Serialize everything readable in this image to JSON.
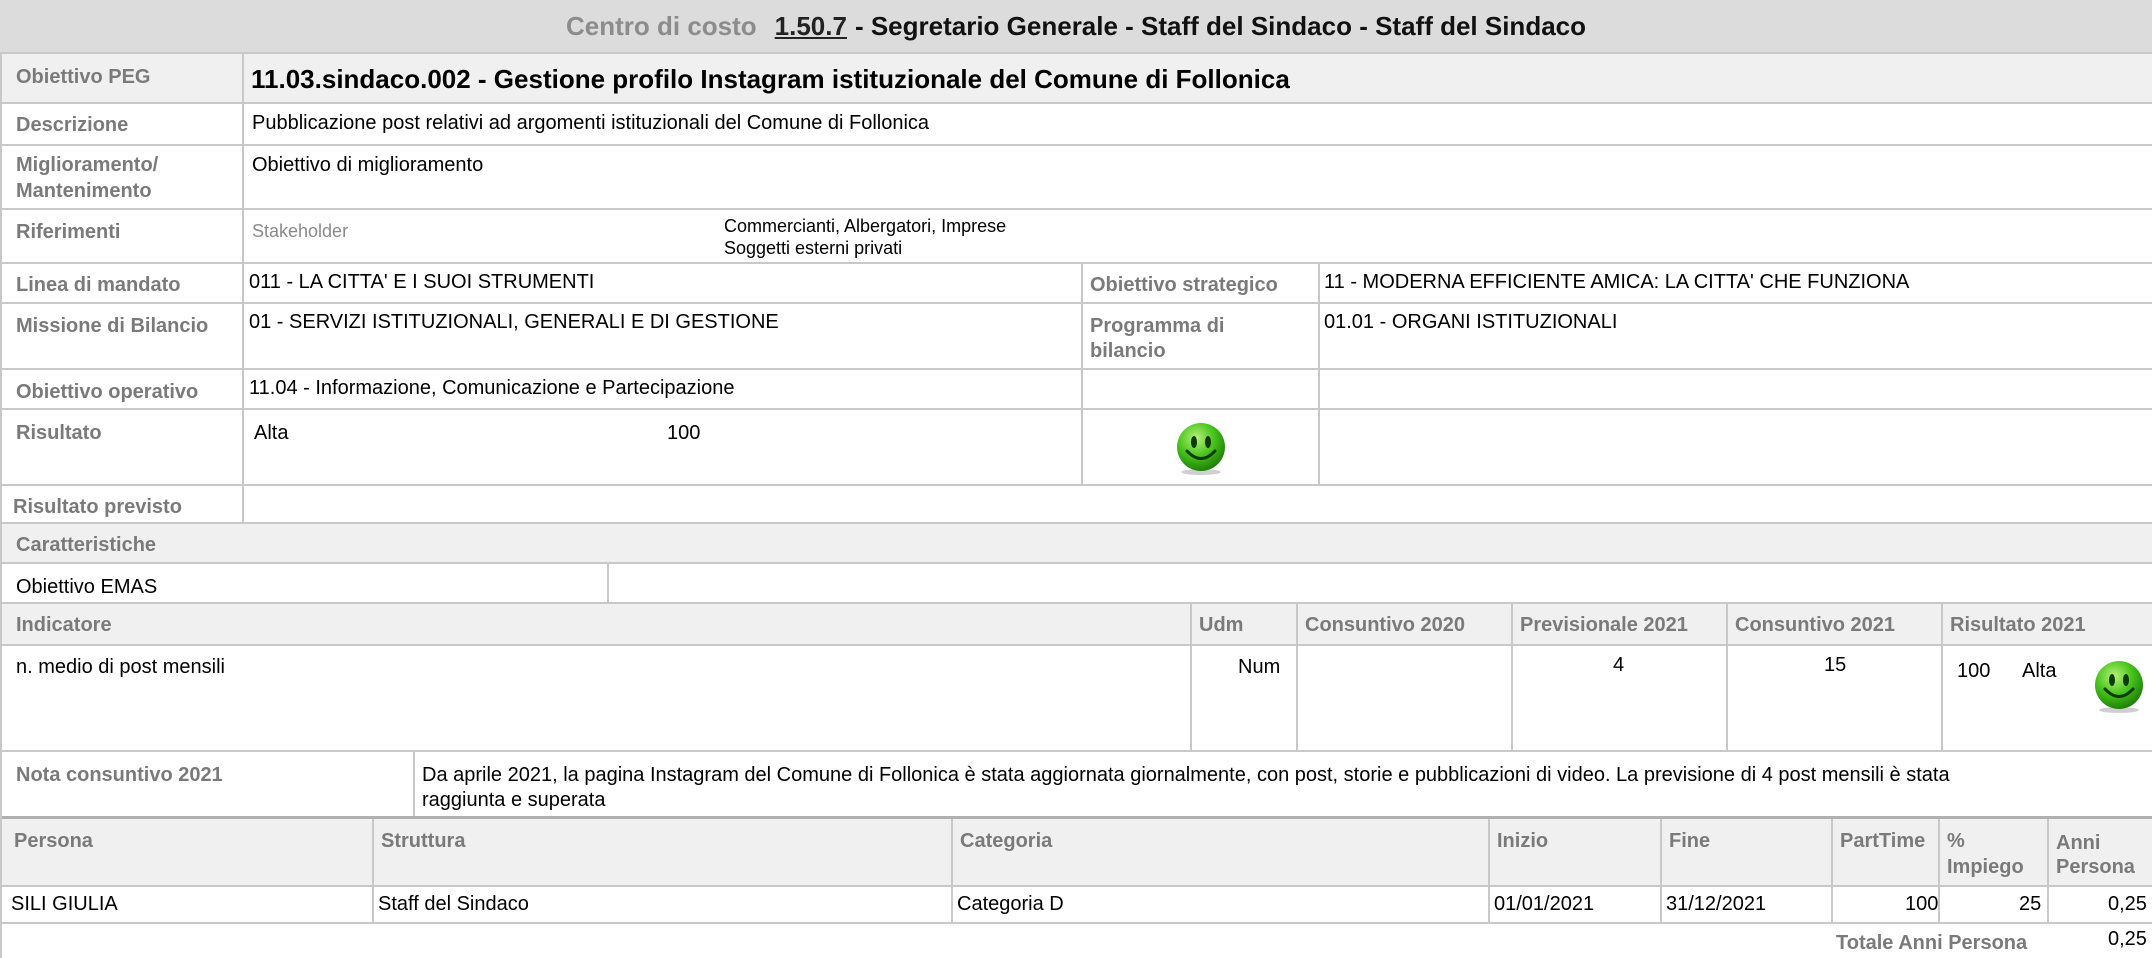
{
  "header": {
    "cost_center_label": "Centro di costo",
    "cost_center_code": "1.50.7",
    "cost_center_name": "- Segretario Generale - Staff del Sindaco - Staff del Sindaco"
  },
  "objective": {
    "peg_label": "Obiettivo PEG",
    "peg_value": "11.03.sindaco.002 - Gestione profilo Instagram istituzionale del Comune di Follonica",
    "description_label": "Descrizione",
    "description_value": "Pubblicazione post relativi ad argomenti istituzionali del Comune di Follonica",
    "improvement_label_1": "Miglioramento/",
    "improvement_label_2": "Mantenimento",
    "improvement_value": "Obiettivo di miglioramento",
    "references_label": "Riferimenti",
    "stakeholder_label": "Stakeholder",
    "stakeholder_line_1": "Commercianti, Albergatori, Imprese",
    "stakeholder_line_2": "Soggetti esterni privati",
    "mandate_label": "Linea di mandato",
    "mandate_value": "011 - LA CITTA' E I SUOI STRUMENTI",
    "strategic_label": "Obiettivo strategico",
    "strategic_value": "11 - MODERNA EFFICIENTE AMICA: LA CITTA' CHE FUNZIONA",
    "mission_label": "Missione di Bilancio",
    "mission_value": "01 - SERVIZI ISTITUZIONALI, GENERALI E DI GESTIONE",
    "program_label_1": "Programma di",
    "program_label_2": "bilancio",
    "program_value": "01.01 - ORGANI ISTITUZIONALI",
    "operative_label": "Obiettivo operativo",
    "operative_value": "11.04 - Informazione, Comunicazione e Partecipazione",
    "result_label": "Risultato",
    "result_level": "Alta",
    "result_score": "100",
    "expected_result_label": "Risultato previsto",
    "characteristics_label": "Caratteristiche",
    "emas_label": "Obiettivo EMAS"
  },
  "indicators": {
    "headers": [
      "Indicatore",
      "Udm",
      "Consuntivo 2020",
      "Previsionale 2021",
      "Consuntivo 2021",
      "Risultato 2021"
    ],
    "row": {
      "name": "n. medio di post mensili",
      "udm": "Num",
      "consuntivo_2020": "",
      "previsionale_2021": "4",
      "consuntivo_2021": "15",
      "risultato_score": "100",
      "risultato_level": "Alta"
    }
  },
  "note": {
    "label": "Nota consuntivo 2021",
    "line_1": "Da aprile 2021, la pagina Instagram del Comune di Follonica è stata aggiornata giornalmente, con post, storie e pubblicazioni di video. La previsione di 4 post mensili è stata",
    "line_2": "raggiunta e superata"
  },
  "staff": {
    "headers": {
      "persona": "Persona",
      "struttura": "Struttura",
      "categoria": "Categoria",
      "inizio": "Inizio",
      "fine": "Fine",
      "parttime": "PartTime",
      "impiego_1": "%",
      "impiego_2": "Impiego",
      "anni_1": "Anni",
      "anni_2": "Persona"
    },
    "rows": [
      {
        "persona": "SILI GIULIA",
        "struttura": "Staff del Sindaco",
        "categoria": "Categoria D",
        "inizio": "01/01/2021",
        "fine": "31/12/2021",
        "parttime": "100",
        "impiego": "25",
        "anni": "0,25"
      }
    ],
    "total_label": "Totale Anni Persona",
    "total_value": "0,25"
  },
  "colors": {
    "label_gray": "#7a7a7a",
    "band_gray": "#eeeeee",
    "border_gray": "#c8c8c8",
    "smiley_green": "#44c21a"
  },
  "icons": {
    "result_icon": "green-smiley-icon",
    "indicator_result_icon": "green-smiley-icon"
  }
}
